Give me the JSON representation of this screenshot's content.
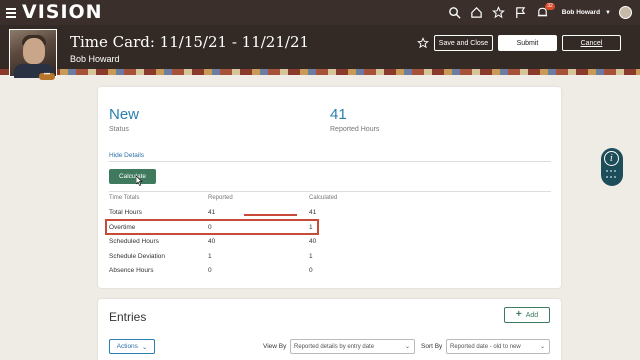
{
  "app": {
    "logo": "VISION"
  },
  "topbar": {
    "username": "Bob Howard",
    "notification_count": "32"
  },
  "header": {
    "title": "Time Card: 11/15/21 - 11/21/21",
    "subtitle": "Bob Howard",
    "save_label": "Save and Close",
    "submit_label": "Submit",
    "cancel_label": "Cancel"
  },
  "summary": {
    "status_value": "New",
    "status_label": "Status",
    "hours_value": "41",
    "hours_label": "Reported Hours",
    "hide_details": "Hide Details",
    "calculate_label": "Calculate"
  },
  "totals": {
    "headers": [
      "Time Totals",
      "Reported",
      "Calculated"
    ],
    "rows": [
      {
        "name": "Total Hours",
        "reported": "41",
        "calculated": "41"
      },
      {
        "name": "Overtime",
        "reported": "0",
        "calculated": "1"
      },
      {
        "name": "Scheduled Hours",
        "reported": "40",
        "calculated": "40"
      },
      {
        "name": "Schedule Deviation",
        "reported": "1",
        "calculated": "1"
      },
      {
        "name": "Absence Hours",
        "reported": "0",
        "calculated": "0"
      }
    ]
  },
  "entries": {
    "title": "Entries",
    "add_label": "Add",
    "actions_label": "Actions",
    "view_by_label": "View By",
    "view_by_value": "Reported details by entry date",
    "sort_by_label": "Sort By",
    "sort_by_value": "Reported date - old to new"
  },
  "colors": {
    "accent": "#2a7fae",
    "primary_button": "#3f7a5f",
    "highlight": "#c94a36",
    "topbar": "#3a2f2a"
  }
}
